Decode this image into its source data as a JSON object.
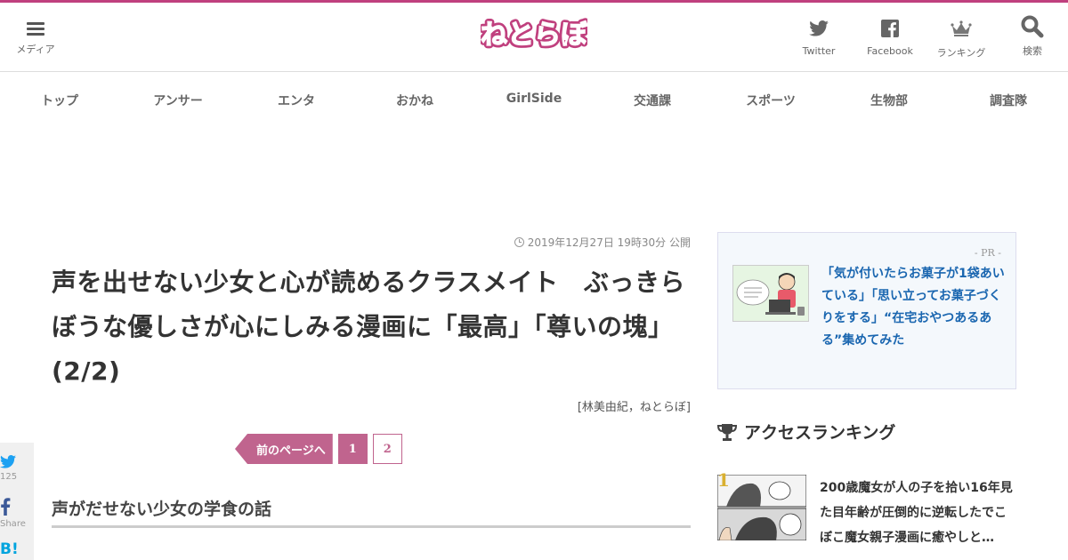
{
  "header": {
    "menu_label": "メディア",
    "logo_text": "ねとらぼ",
    "twitter_label": "Twitter",
    "facebook_label": "Facebook",
    "ranking_label": "ランキング",
    "search_label": "検索"
  },
  "nav": {
    "items": [
      "トップ",
      "アンサー",
      "エンタ",
      "おかね",
      "GirlSide",
      "交通課",
      "スポーツ",
      "生物部",
      "調査隊"
    ]
  },
  "article": {
    "date": "2019年12月27日 19時30分 公開",
    "title": "声を出せない少女と心が読めるクラスメイト　ぶっきらぼうな優しさが心にしみる漫画に「最高」「尊いの塊」 (2/2)",
    "byline": "[林美由紀，ねとらぼ]",
    "subhead": "声がだせない少女の学食の話"
  },
  "pager": {
    "prev_label": "前のページへ",
    "current": "1",
    "other": "2"
  },
  "share": {
    "twitter_count": "125",
    "facebook_label": "Share",
    "hatena_label": "B!"
  },
  "sidebar": {
    "pr_tag": "- PR -",
    "pr_text": "「気が付いたらお菓子が1袋あいている」「思い立ってお菓子づくりをする」“在宅おやつあるある”集めてみた",
    "ranking_title": "アクセスランキング",
    "rank1_num": "1",
    "rank1_text": "200歳魔女が人の子を拾い16年見た目年齢が圧倒的に逆転したでこぼこ魔女親子漫画に癒やしと…"
  },
  "colors": {
    "brand": "#c0407e",
    "pager": "#c0648e",
    "link": "#1a66b0",
    "rank_gold": "#d9b030"
  }
}
